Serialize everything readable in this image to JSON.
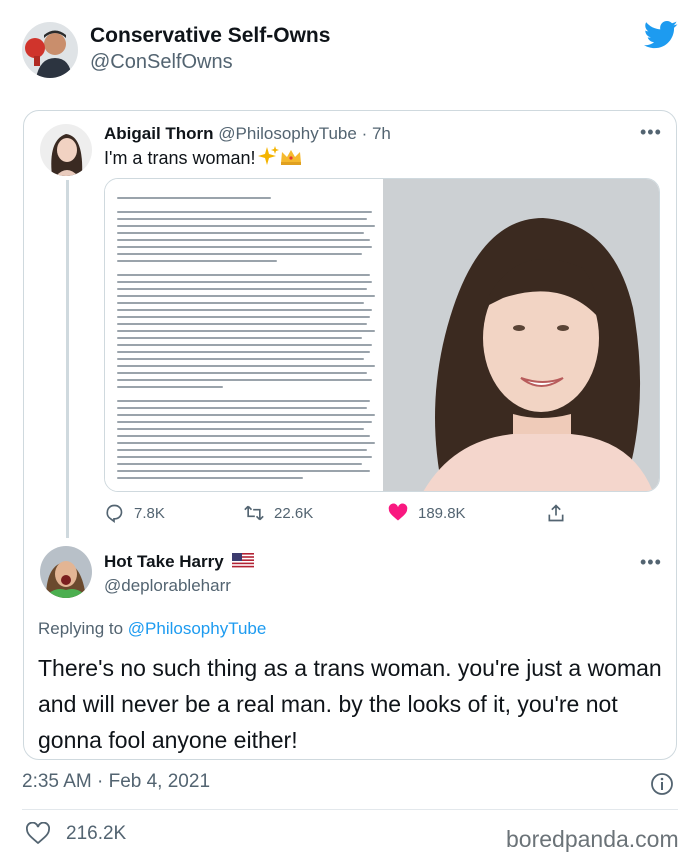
{
  "outer_tweet": {
    "name": "Conservative Self-Owns",
    "handle": "@ConSelfOwns",
    "timestamp": "2:35 AM · Feb 4, 2021",
    "like_count": "216.2K"
  },
  "quoted_tweet": {
    "name": "Abigail Thorn",
    "handle": "@PhilosophyTube",
    "time": "· 7h",
    "text": "I'm a trans woman!",
    "reply_count": "7.8K",
    "retweet_count": "22.6K",
    "like_count": "189.8K"
  },
  "reply_tweet": {
    "name": "Hot Take Harry",
    "handle": "@deplorableharr",
    "replying_prefix": "Replying to",
    "replying_to": "@PhilosophyTube",
    "text": "There's no such thing as a trans woman. you're just a woman and will never be a real man. by the looks of it, you're not gonna fool anyone either!"
  },
  "watermark": "boredpanda.com",
  "colors": {
    "twitter_blue": "#1d9bf0",
    "like_red": "#f91880",
    "secondary_text": "#536471"
  },
  "icons": [
    "twitter-bird-icon",
    "more-icon",
    "reply-icon",
    "retweet-icon",
    "heart-icon",
    "share-icon",
    "info-icon",
    "us-flag-icon",
    "sparkles-icon",
    "crown-icon"
  ]
}
